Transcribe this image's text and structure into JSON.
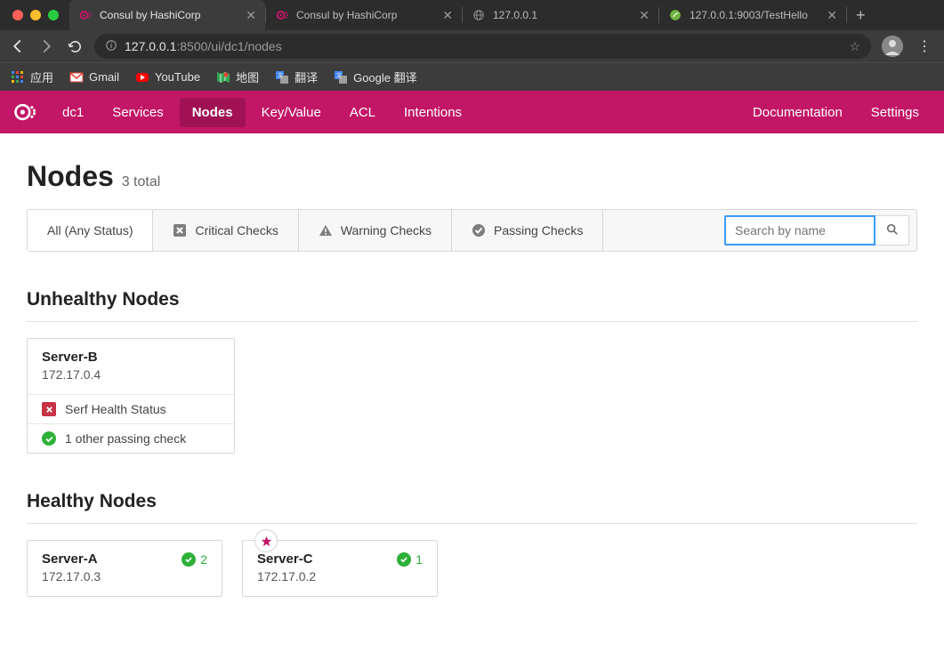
{
  "browser": {
    "tabs": [
      {
        "title": "Consul by HashiCorp",
        "fav": "consul"
      },
      {
        "title": "Consul by HashiCorp",
        "fav": "consul"
      },
      {
        "title": "127.0.0.1",
        "fav": "globe"
      },
      {
        "title": "127.0.0.1:9003/TestHello",
        "fav": "spring"
      }
    ],
    "url_host": "127.0.0.1",
    "url_port_path": ":8500/ui/dc1/nodes",
    "bookmarks": [
      {
        "label": "应用",
        "icon": "apps"
      },
      {
        "label": "Gmail",
        "icon": "gmail"
      },
      {
        "label": "YouTube",
        "icon": "youtube"
      },
      {
        "label": "地图",
        "icon": "maps"
      },
      {
        "label": "翻译",
        "icon": "translate"
      },
      {
        "label": "Google 翻译",
        "icon": "translate"
      }
    ]
  },
  "header": {
    "dc": "dc1",
    "nav": [
      "Services",
      "Nodes",
      "Key/Value",
      "ACL",
      "Intentions"
    ],
    "active": "Nodes",
    "right": [
      "Documentation",
      "Settings"
    ]
  },
  "page": {
    "title": "Nodes",
    "count_text": "3 total",
    "filters": {
      "all": "All (Any Status)",
      "critical": "Critical Checks",
      "warning": "Warning Checks",
      "passing": "Passing Checks"
    },
    "search_placeholder": "Search by name",
    "sections": {
      "unhealthy": "Unhealthy Nodes",
      "healthy": "Healthy Nodes"
    },
    "unhealthy_nodes": [
      {
        "name": "Server-B",
        "ip": "172.17.0.4",
        "checks": [
          {
            "status": "critical",
            "text": "Serf Health Status"
          },
          {
            "status": "passing",
            "text": "1 other passing check"
          }
        ]
      }
    ],
    "healthy_nodes": [
      {
        "name": "Server-A",
        "ip": "172.17.0.3",
        "passing": "2",
        "leader": false
      },
      {
        "name": "Server-C",
        "ip": "172.17.0.2",
        "passing": "1",
        "leader": true
      }
    ]
  }
}
